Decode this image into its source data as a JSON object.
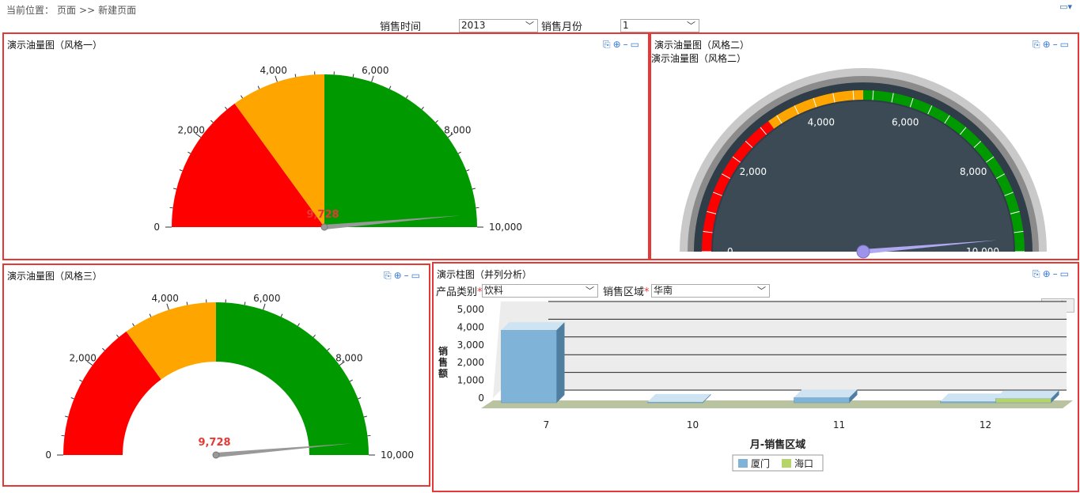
{
  "breadcrumb": {
    "label": "当前位置：",
    "page": "页面",
    "sep": ">>",
    "current": "新建页面"
  },
  "filters": {
    "sales_time_label": "销售时间",
    "sales_time_value": "2013",
    "sales_month_label": "销售月份",
    "sales_month_value": "1"
  },
  "panel1": {
    "title": "演示油量图（风格一）"
  },
  "panel2": {
    "title": "演示油量图（风格二）",
    "subtitle": "演示油量图（风格二）"
  },
  "panel3": {
    "title": "演示油量图（风格三）"
  },
  "panel4": {
    "title": "演示柱图（并列分析）",
    "category_label": "产品类别",
    "category_value": "饮料",
    "region_label": "销售区域",
    "region_value": "华南",
    "required_mark": "*"
  },
  "gauge": {
    "min": 0,
    "max": 10000,
    "value": 9728,
    "value_label": "9,728",
    "ticks": [
      "0",
      "2,000",
      "4,000",
      "6,000",
      "8,000",
      "10,000"
    ],
    "bands": [
      {
        "from": 0,
        "to": 3000,
        "color": "#ff0000"
      },
      {
        "from": 3000,
        "to": 5000,
        "color": "#ffa500"
      },
      {
        "from": 5000,
        "to": 10000,
        "color": "#009900"
      }
    ]
  },
  "chart_data": {
    "type": "bar",
    "categories": [
      "7",
      "10",
      "11",
      "12"
    ],
    "series": [
      {
        "name": "厦门",
        "values": [
          4100,
          50,
          300,
          80
        ],
        "color": "#7fb4d8"
      },
      {
        "name": "海口",
        "values": [
          0,
          0,
          0,
          250
        ],
        "color": "#b5d56b"
      }
    ],
    "xlabel": "月-销售区域",
    "ylabel": "销售额",
    "ylim": [
      0,
      5000
    ],
    "yticks": [
      "0",
      "1,000",
      "2,000",
      "3,000",
      "4,000",
      "5,000"
    ],
    "legend": "bottom"
  }
}
